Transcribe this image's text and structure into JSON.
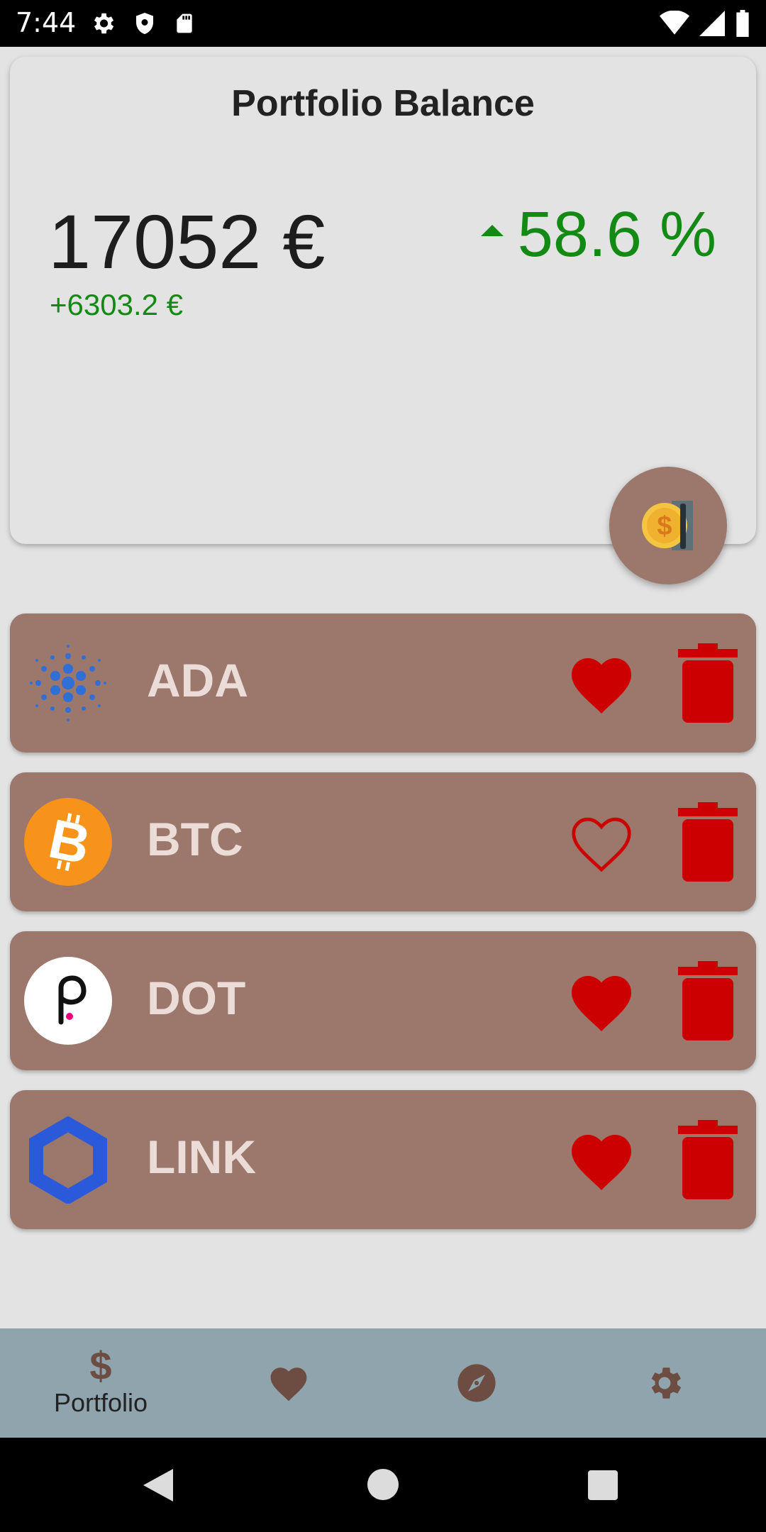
{
  "status_bar": {
    "time": "7:44",
    "icons_left": [
      "gear-icon",
      "shield-icon",
      "sd-card-icon"
    ],
    "icons_right": [
      "wifi-icon",
      "signal-icon",
      "battery-icon"
    ]
  },
  "balance_card": {
    "title": "Portfolio Balance",
    "balance": "17052 €",
    "change_amount": "+6303.2 €",
    "change_percent": "58.6 %",
    "trend": "up",
    "positive_color": "#138a13"
  },
  "fab": {
    "icon": "coin-deposit-icon"
  },
  "coins": [
    {
      "symbol": "ADA",
      "icon": "cardano-icon",
      "favorite": true
    },
    {
      "symbol": "BTC",
      "icon": "bitcoin-icon",
      "favorite": false
    },
    {
      "symbol": "DOT",
      "icon": "polkadot-icon",
      "favorite": true
    },
    {
      "symbol": "LINK",
      "icon": "chainlink-icon",
      "favorite": true
    }
  ],
  "bottom_nav": {
    "items": [
      {
        "icon": "dollar-icon",
        "label": "Portfolio",
        "active": true
      },
      {
        "icon": "heart-icon",
        "label": "",
        "active": false
      },
      {
        "icon": "compass-icon",
        "label": "",
        "active": false
      },
      {
        "icon": "settings-icon",
        "label": "",
        "active": false
      }
    ]
  },
  "colors": {
    "card_bg": "#9c776c",
    "accent_red": "#cc0000",
    "nav_bg": "#90a4ae",
    "nav_icon": "#6d4c41"
  }
}
